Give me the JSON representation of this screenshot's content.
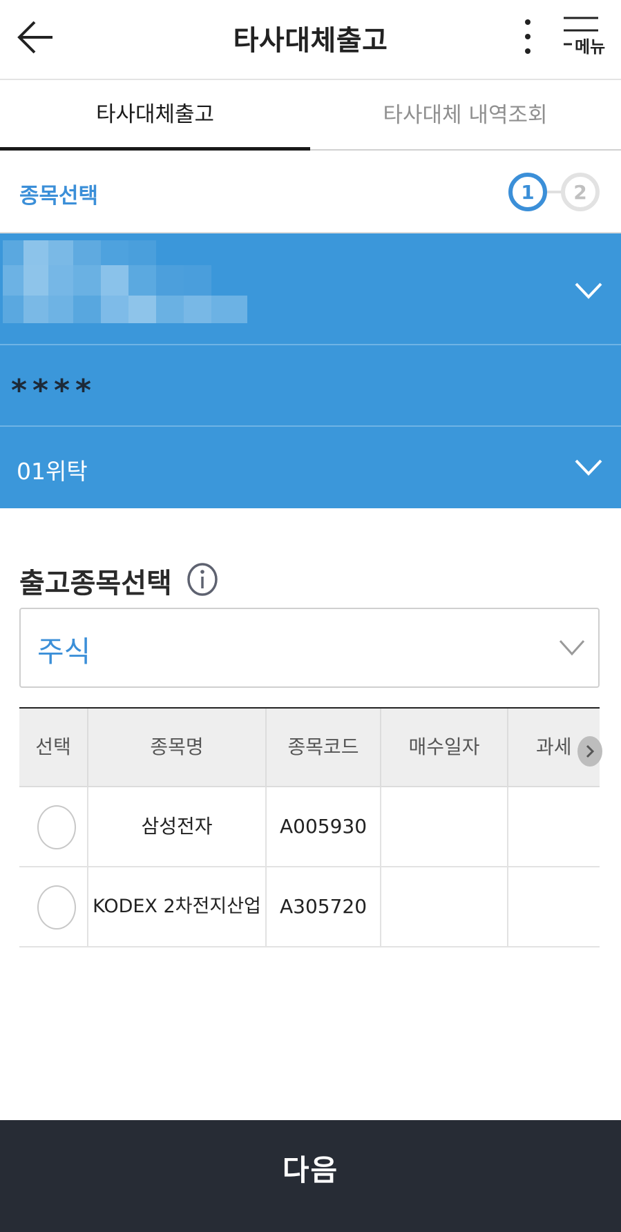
{
  "header": {
    "title": "타사대체출고",
    "menu_label": "메뉴"
  },
  "tabs": [
    {
      "label": "타사대체출고",
      "active": true
    },
    {
      "label": "타사대체 내역조회",
      "active": false
    }
  ],
  "step_bar": {
    "label": "종목선택",
    "steps": [
      "1",
      "2"
    ],
    "current_step": 1
  },
  "account": {
    "password_mask": "****",
    "account_type": "01위탁"
  },
  "section": {
    "title": "출고종목선택"
  },
  "asset_select": {
    "value": "주식"
  },
  "table": {
    "headers": [
      "선택",
      "종목명",
      "종목코드",
      "매수일자",
      "과세"
    ],
    "rows": [
      {
        "name": "삼성전자",
        "code": "A005930",
        "buy_date": "",
        "tax": ""
      },
      {
        "name": "KODEX 2차전지산업",
        "code": "A305720",
        "buy_date": "",
        "tax": ""
      }
    ]
  },
  "footer": {
    "next_label": "다음"
  },
  "colors": {
    "accent_blue": "#3b97da",
    "text_blue": "#3b8fd8",
    "footer_dark": "#272c35"
  }
}
